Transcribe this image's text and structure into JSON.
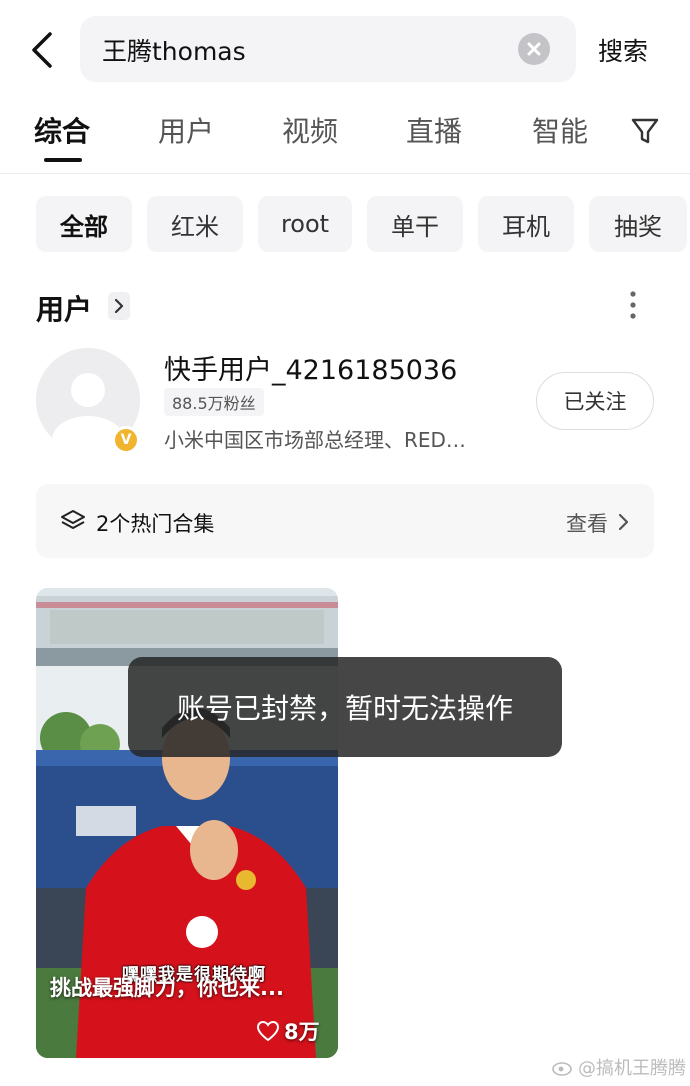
{
  "search": {
    "query": "王腾thomas",
    "submit_label": "搜索"
  },
  "tabs": [
    {
      "label": "综合",
      "active": true
    },
    {
      "label": "用户",
      "active": false
    },
    {
      "label": "视频",
      "active": false
    },
    {
      "label": "直播",
      "active": false
    },
    {
      "label": "智能",
      "active": false
    }
  ],
  "chips": [
    {
      "label": "全部",
      "active": true
    },
    {
      "label": "红米",
      "active": false
    },
    {
      "label": "root",
      "active": false
    },
    {
      "label": "单干",
      "active": false
    },
    {
      "label": "耳机",
      "active": false
    },
    {
      "label": "抽奖",
      "active": false
    }
  ],
  "users_section": {
    "title": "用户",
    "user": {
      "name": "快手用户_4216185036",
      "fans": "88.5万粉丝",
      "bio": "小米中国区市场部总经理、RED…",
      "verified_badge": "V",
      "follow_label": "已关注"
    },
    "collection": {
      "text": "2个热门合集",
      "view_label": "查看"
    }
  },
  "video": {
    "title": "挑战最强脚力，你也来...",
    "likes": "8万",
    "burned_subtitle": "嘿嘿我是很期待啊"
  },
  "toast": {
    "message": "账号已封禁，暂时无法操作"
  },
  "watermark": {
    "text": "@搞机王腾腾"
  },
  "colors": {
    "accent_badge": "#f1b42f",
    "search_bg": "#f4f4f6",
    "jersey_red": "#d5121b"
  }
}
